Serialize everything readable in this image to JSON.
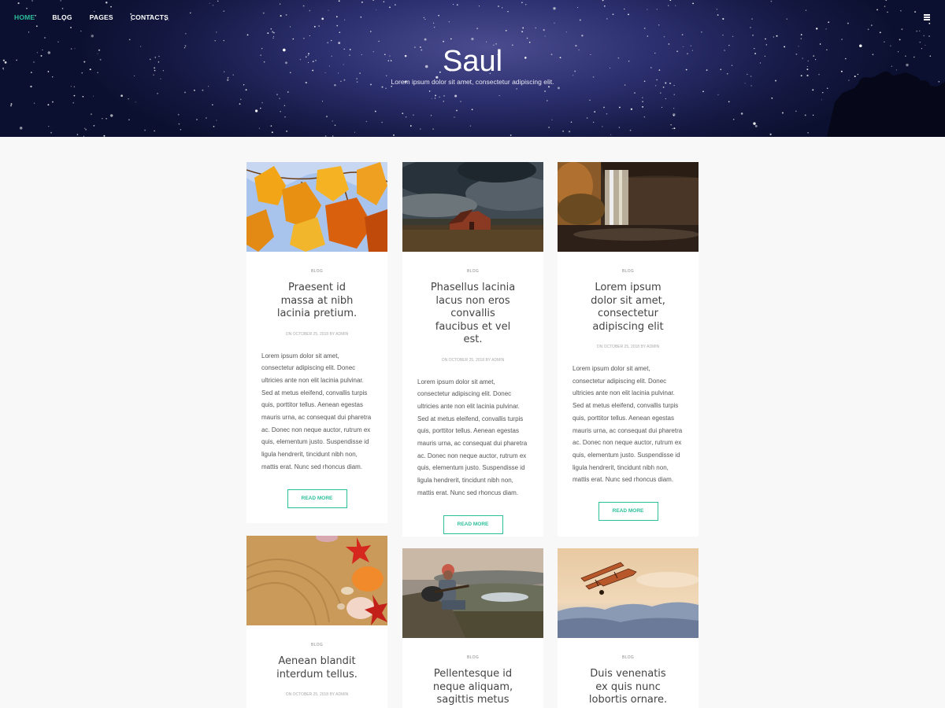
{
  "nav": {
    "items": [
      {
        "label": "HOME",
        "active": true
      },
      {
        "label": "BLOG",
        "active": false
      },
      {
        "label": "PAGES",
        "active": false
      },
      {
        "label": "CONTACTS",
        "active": false
      }
    ],
    "menu_icon": "hamburger-menu-icon"
  },
  "site": {
    "title": "Saul",
    "description": "Lorem ipsum dolor sit amet, consectetur adipiscing elit."
  },
  "colors": {
    "accent": "#2bbf9a",
    "hero_bg": "#1c2055",
    "page_bg": "#f8f8f8"
  },
  "posts": [
    {
      "category": "BLOG",
      "title": "Praesent id massa at nibh lacinia pretium.",
      "meta": "ON OCTOBER 25, 2018 BY ADMIN",
      "excerpt": "Lorem ipsum dolor sit amet, consectetur adipiscing elit. Donec ultricies ante non elit lacinia pulvinar. Sed at metus eleifend, convallis turpis quis, porttitor tellus. Aenean egestas mauris urna, ac consequat dui pharetra ac. Donec non neque auctor, rutrum ex quis, elementum justo. Suspendisse id ligula hendrerit, tincidunt nibh non, mattis erat. Nunc sed rhoncus diam.",
      "button": "READ MORE",
      "image": "autumn-leaves-image"
    },
    {
      "category": "BLOG",
      "title": "Phasellus lacinia lacus non eros convallis faucibus et vel est.",
      "meta": "ON OCTOBER 25, 2018 BY ADMIN",
      "excerpt": "Lorem ipsum dolor sit amet, consectetur adipiscing elit. Donec ultricies ante non elit lacinia pulvinar. Sed at metus eleifend, convallis turpis quis, porttitor tellus. Aenean egestas mauris urna, ac consequat dui pharetra ac. Donec non neque auctor, rutrum ex quis, elementum justo. Suspendisse id ligula hendrerit, tincidunt nibh non, mattis erat. Nunc sed rhoncus diam.",
      "button": "READ MORE",
      "image": "barn-storm-image"
    },
    {
      "category": "BLOG",
      "title": "Lorem ipsum dolor sit amet, consectetur adipiscing elit",
      "meta": "ON OCTOBER 25, 2018 BY ADMIN",
      "excerpt": "Lorem ipsum dolor sit amet, consectetur adipiscing elit. Donec ultricies ante non elit lacinia pulvinar. Sed at metus eleifend, convallis turpis quis, porttitor tellus. Aenean egestas mauris urna, ac consequat dui pharetra ac. Donec non neque auctor, rutrum ex quis, elementum justo. Suspendisse id ligula hendrerit, tincidunt nibh non, mattis erat. Nunc sed rhoncus diam.",
      "button": "READ MORE",
      "image": "waterfall-image"
    },
    {
      "category": "BLOG",
      "title": "Aenean blandit interdum tellus.",
      "meta": "ON OCTOBER 25, 2018 BY ADMIN",
      "image": "seashells-sand-image"
    },
    {
      "category": "BLOG",
      "title": "Pellentesque id neque aliquam, sagittis metus",
      "image": "guitarist-mountain-image"
    },
    {
      "category": "BLOG",
      "title": "Duis venenatis ex quis nunc lobortis ornare.",
      "image": "biplane-sky-image"
    }
  ]
}
